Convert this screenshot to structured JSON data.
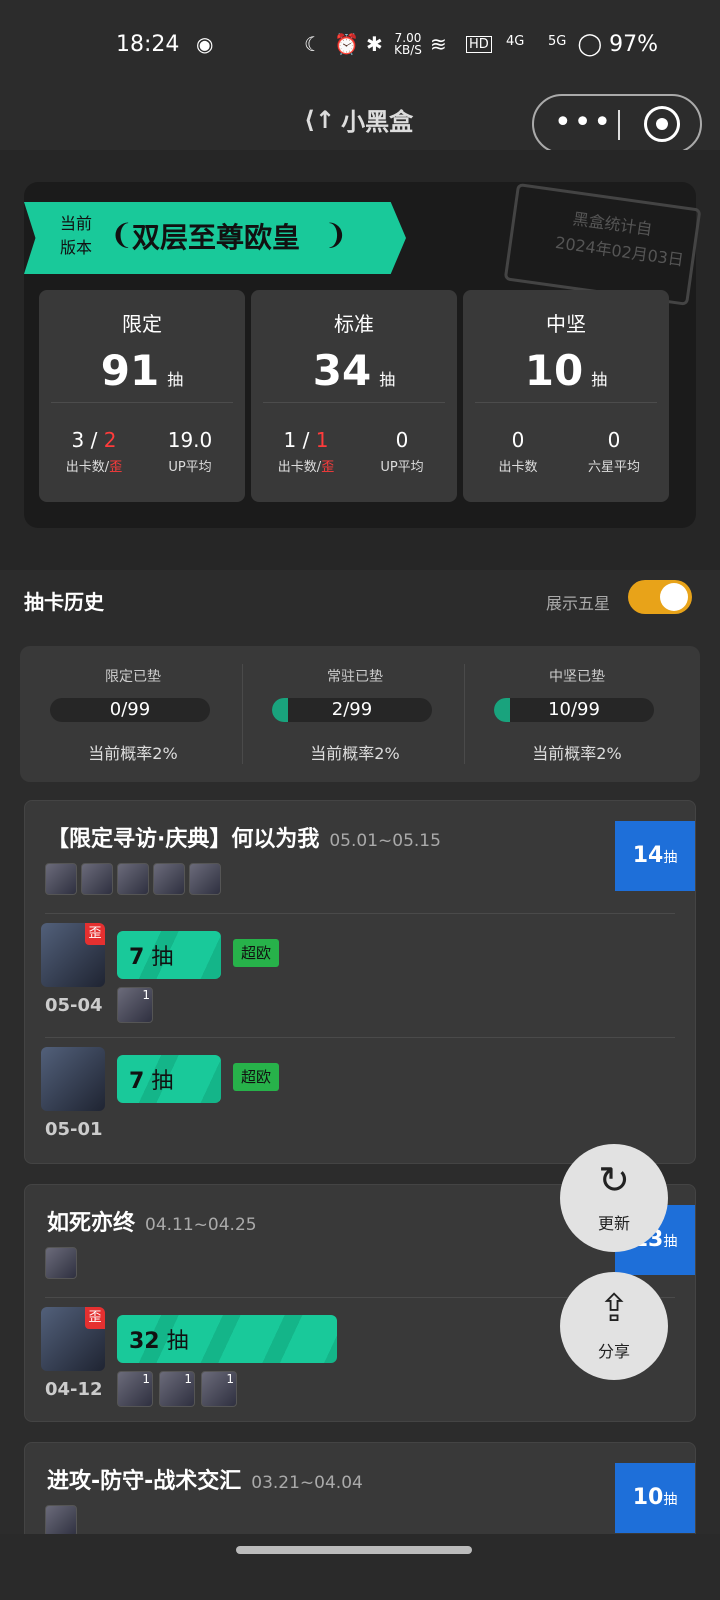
{
  "status": {
    "time": "18:24",
    "speed": "7.00 KB/S",
    "hd": "HD",
    "net1": "4G",
    "net2": "5G",
    "battery": "97%"
  },
  "titlebar": {
    "app_name": "小黑盒"
  },
  "hero": {
    "ribbon_label": "当前\n版本",
    "ribbon_title": "双层至尊欧皇",
    "stamp_line1": "黑盒统计自",
    "stamp_line2": "2024年02月03日",
    "stats": [
      {
        "title": "限定",
        "count": "91",
        "unit": "抽",
        "left_value_a": "3",
        "left_value_b": "2",
        "left_label_a": "出卡数",
        "left_label_b": "歪",
        "right_value": "19.0",
        "right_label": "UP平均"
      },
      {
        "title": "标准",
        "count": "34",
        "unit": "抽",
        "left_value_a": "1",
        "left_value_b": "1",
        "left_label_a": "出卡数",
        "left_label_b": "歪",
        "right_value": "0",
        "right_label": "UP平均"
      },
      {
        "title": "中坚",
        "count": "10",
        "unit": "抽",
        "left_value_a": "0",
        "left_label_a": "出卡数",
        "right_value": "0",
        "right_label": "六星平均"
      }
    ]
  },
  "history": {
    "title": "抽卡历史",
    "toggle_label": "展示五星",
    "toggle_on": true
  },
  "pity": [
    {
      "title": "限定已垫",
      "value": "0/99",
      "fill": 0.0,
      "rate": "当前概率2%"
    },
    {
      "title": "常驻已垫",
      "value": "2/99",
      "fill": 0.02,
      "rate": "当前概率2%"
    },
    {
      "title": "中坚已垫",
      "value": "10/99",
      "fill": 0.1,
      "rate": "当前概率2%"
    }
  ],
  "banners": [
    {
      "name": "【限定寻访·庆典】何以为我",
      "date": "05.01~05.15",
      "total": "14",
      "unit": "抽",
      "pulls": [
        {
          "date": "05-04",
          "count": "7",
          "unit": "抽",
          "badge": "超欧",
          "wai": "歪",
          "sub_counts": [
            "1"
          ]
        },
        {
          "date": "05-01",
          "count": "7",
          "unit": "抽",
          "badge": "超欧"
        }
      ]
    },
    {
      "name": "如死亦终",
      "date": "04.11~04.25",
      "total": "13",
      "unit": "抽",
      "pulls": [
        {
          "date": "04-12",
          "count": "32",
          "unit": "抽",
          "wai": "歪",
          "sub_counts": [
            "1",
            "1",
            "1"
          ]
        }
      ]
    },
    {
      "name": "进攻-防守-战术交汇",
      "date": "03.21~04.04",
      "total": "10",
      "unit": "抽"
    }
  ],
  "fab": {
    "refresh_label": "更新",
    "share_label": "分享"
  },
  "colors": {
    "accent": "#19c99a",
    "tag_blue": "#1e6fd9",
    "toggle": "#e8a319",
    "wai_red": "#e53030"
  }
}
